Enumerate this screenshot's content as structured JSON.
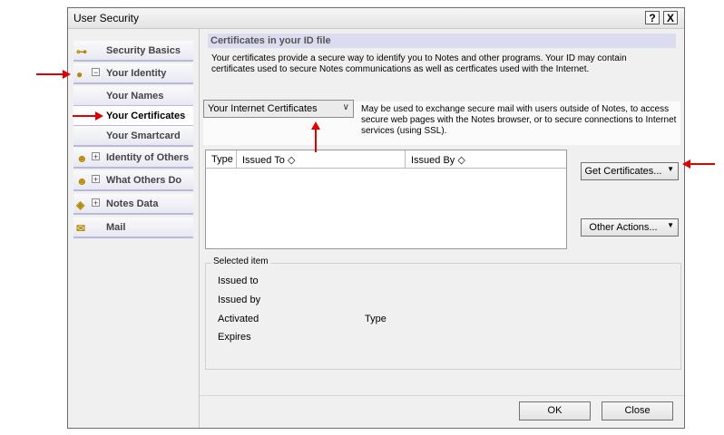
{
  "window": {
    "title": "User Security",
    "help_label": "?",
    "close_label": "X"
  },
  "sidebar": {
    "items": [
      {
        "label": "Security Basics",
        "icon": "key-icon"
      },
      {
        "label": "Your Identity",
        "icon": "identity-icon",
        "expander": "−"
      },
      {
        "label": "Your Names"
      },
      {
        "label": "Your Certificates",
        "selected": true
      },
      {
        "label": "Your Smartcard"
      },
      {
        "label": "Identity of Others",
        "icon": "people-icon",
        "expander": "+"
      },
      {
        "label": "What Others Do",
        "icon": "group-icon",
        "expander": "+"
      },
      {
        "label": "Notes Data",
        "icon": "data-icon",
        "expander": "+"
      },
      {
        "label": "Mail",
        "icon": "mail-icon"
      }
    ]
  },
  "main": {
    "section_title": "Certificates in your ID file",
    "description": "Your certificates provide a secure way to identify you to Notes and other programs. Your ID may contain certificates used to secure Notes communications as well as certficates used with the Internet.",
    "certificate_type": {
      "selected": "Your Internet Certificates",
      "note": "May be used to exchange secure mail with users outside of Notes, to access secure web pages with the Notes browser, or to secure connections to Internet services (using SSL)."
    },
    "table": {
      "columns": [
        "Type",
        "Issued To",
        "Issued By"
      ],
      "rows": []
    },
    "buttons": {
      "get_certificates": "Get Certificates...",
      "other_actions": "Other Actions..."
    },
    "selected_item": {
      "legend": "Selected item",
      "issued_to": "Issued to",
      "issued_by": "Issued by",
      "activated": "Activated",
      "type": "Type",
      "expires": "Expires"
    }
  },
  "footer": {
    "ok": "OK",
    "close": "Close"
  },
  "annotation_color": "#e00000"
}
